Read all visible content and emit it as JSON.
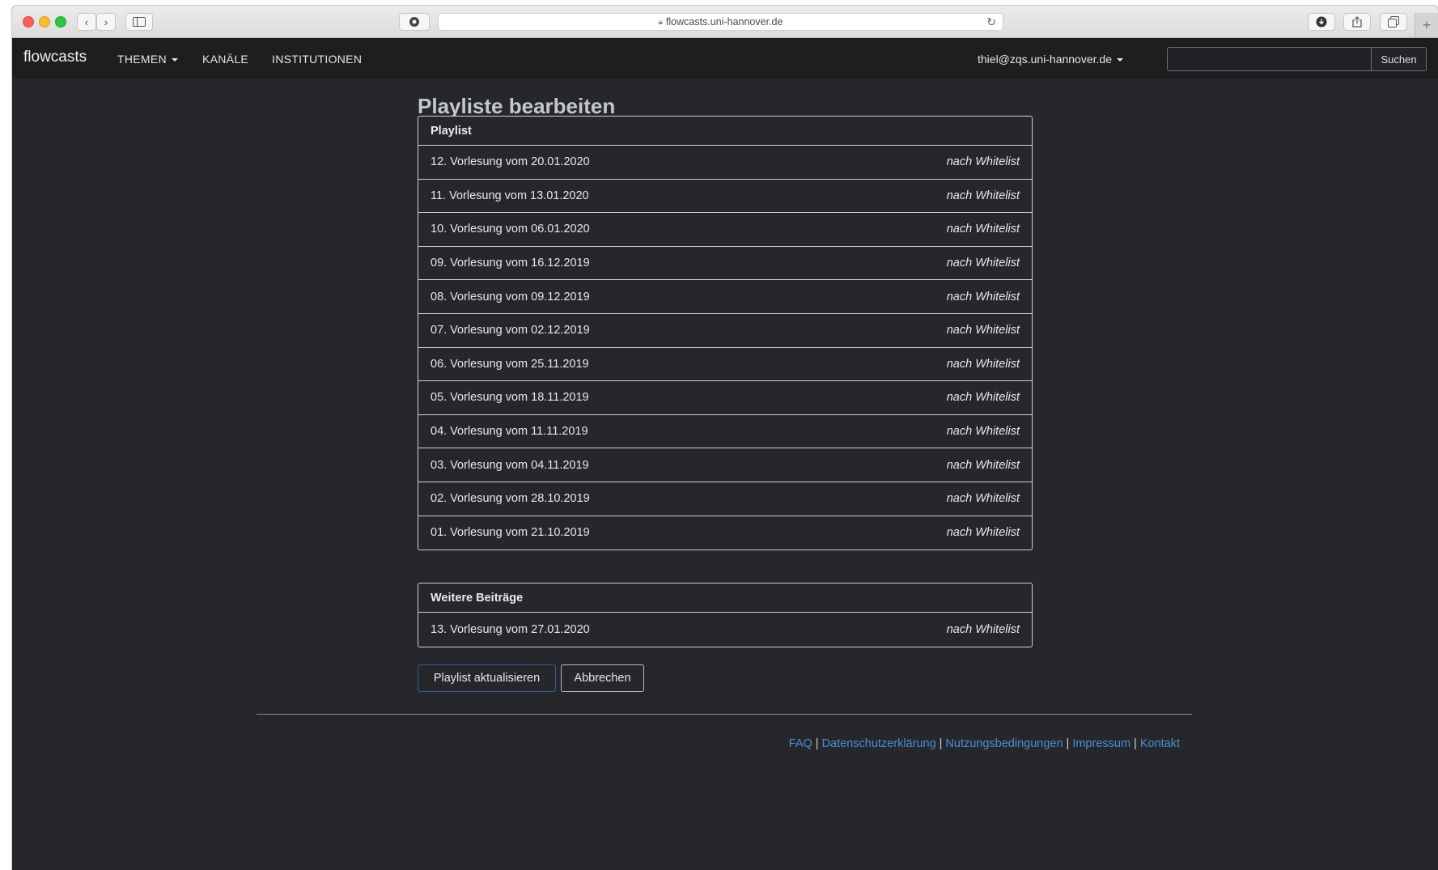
{
  "browser": {
    "url": "flowcasts.uni-hannover.de"
  },
  "navbar": {
    "brand": "flowcasts",
    "items": [
      {
        "label": "THEMEN",
        "dropdown": true
      },
      {
        "label": "KANÄLE",
        "dropdown": false
      },
      {
        "label": "INSTITUTIONEN",
        "dropdown": false
      }
    ],
    "user": "thiel@zqs.uni-hannover.de",
    "search_value": "",
    "search_button": "Suchen"
  },
  "page": {
    "title": "Playliste bearbeiten"
  },
  "playlist": {
    "heading": "Playlist",
    "items": [
      {
        "title": "12. Vorlesung vom 20.01.2020",
        "status": "nach Whitelist"
      },
      {
        "title": "11. Vorlesung vom 13.01.2020",
        "status": "nach Whitelist"
      },
      {
        "title": "10. Vorlesung vom 06.01.2020",
        "status": "nach Whitelist"
      },
      {
        "title": "09. Vorlesung vom 16.12.2019",
        "status": "nach Whitelist"
      },
      {
        "title": "08. Vorlesung vom 09.12.2019",
        "status": "nach Whitelist"
      },
      {
        "title": "07. Vorlesung vom 02.12.2019",
        "status": "nach Whitelist"
      },
      {
        "title": "06. Vorlesung vom 25.11.2019",
        "status": "nach Whitelist"
      },
      {
        "title": "05. Vorlesung vom 18.11.2019",
        "status": "nach Whitelist"
      },
      {
        "title": "04. Vorlesung vom 11.11.2019",
        "status": "nach Whitelist"
      },
      {
        "title": "03. Vorlesung vom 04.11.2019",
        "status": "nach Whitelist"
      },
      {
        "title": "02. Vorlesung vom 28.10.2019",
        "status": "nach Whitelist"
      },
      {
        "title": "01. Vorlesung vom 21.10.2019",
        "status": "nach Whitelist"
      }
    ]
  },
  "more": {
    "heading": "Weitere Beiträge",
    "items": [
      {
        "title": "13. Vorlesung vom 27.01.2020",
        "status": "nach Whitelist"
      }
    ]
  },
  "actions": {
    "update": "Playlist aktualisieren",
    "cancel": "Abbrechen"
  },
  "footer": {
    "links": [
      "FAQ",
      "Datenschutzerklärung",
      "Nutzungsbedingungen",
      "Impressum",
      "Kontakt"
    ],
    "separator": "|"
  },
  "colors": {
    "background": "#25272a",
    "navbar": "#1d1e20",
    "link": "#4a8fd6",
    "primary_border": "#2f5f95"
  }
}
